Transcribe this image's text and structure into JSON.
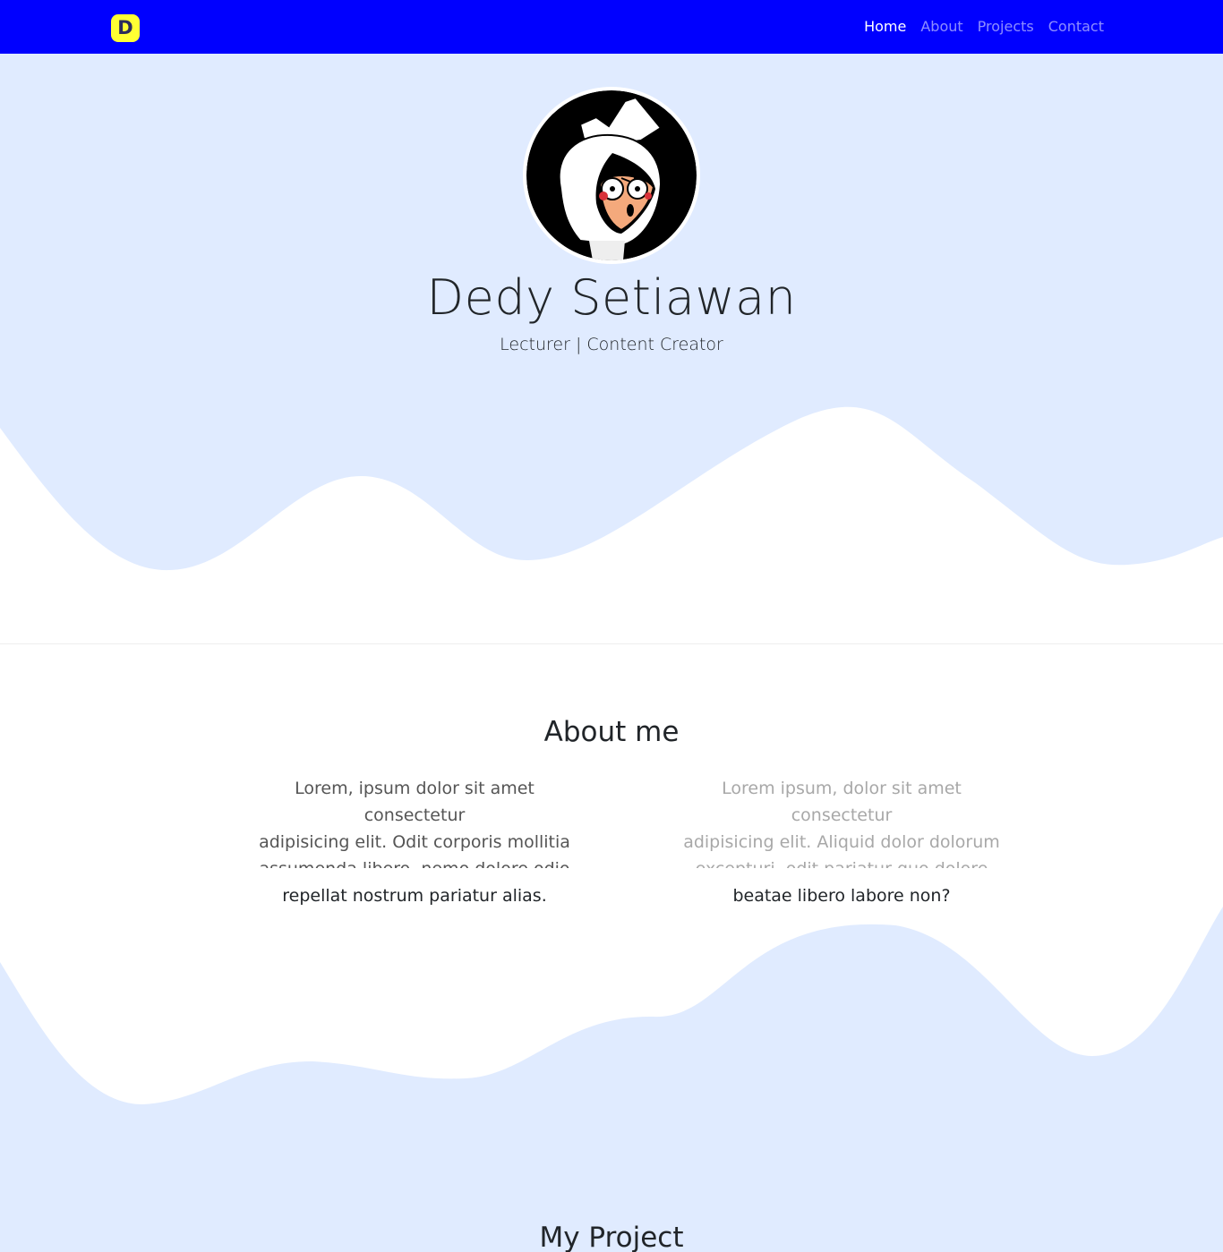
{
  "brand": {
    "letter": "D"
  },
  "nav": {
    "home": "Home",
    "about": "About",
    "projects": "Projects",
    "contact": "Contact"
  },
  "hero": {
    "name": "Dedy Setiawan",
    "role": "Lecturer | Content Creator"
  },
  "about": {
    "title": "About me",
    "left_line1": "Lorem, ipsum dolor sit amet consectetur",
    "left_line2": "adipisicing elit. Odit corporis mollitia",
    "left_line3": "assumenda libero, nemo dolore odio",
    "left_line4": "repellat nostrum pariatur alias.",
    "right_line1": "Lorem ipsum, dolor sit amet consectetur",
    "right_line2": "adipisicing elit. Aliquid dolor dolorum",
    "right_line3": "excepturi, odit pariatur quo dolore",
    "right_line4": "beatae libero labore non?"
  },
  "projects": {
    "title": "My Project"
  },
  "colors": {
    "navbar": "#0000ff",
    "brand_bg": "#ffff33",
    "hero_bg": "#e0ebff"
  }
}
